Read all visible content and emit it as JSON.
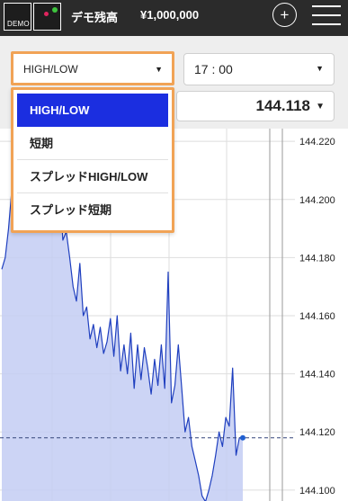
{
  "header": {
    "logo_text": "DEMO",
    "mode_label": "デモ残高",
    "balance": "¥1,000,000",
    "plus_icon": "+"
  },
  "controls": {
    "trade_type": "HIGH/LOW",
    "expiry_time": "17 : 00",
    "rate": "144.118",
    "caret": "▼"
  },
  "dropdown": {
    "items": [
      "HIGH/LOW",
      "短期",
      "スプレッドHIGH/LOW",
      "スプレッド短期"
    ],
    "selected_index": 0
  },
  "chart_data": {
    "type": "area",
    "title": "",
    "xlabel": "",
    "ylabel": "",
    "ylim": [
      144.095,
      144.225
    ],
    "yticks": [
      "144.220",
      "144.200",
      "144.180",
      "144.160",
      "144.140",
      "144.120",
      "144.100"
    ],
    "current_rate": 144.118,
    "series": [
      {
        "values": [
          144.176,
          144.18,
          144.19,
          144.204,
          144.196,
          144.21,
          144.213,
          144.218,
          144.215,
          144.221,
          144.219,
          144.217,
          144.22,
          144.22,
          144.219,
          144.216,
          144.202,
          144.206,
          144.186,
          144.189,
          144.18,
          144.17,
          144.165,
          144.178,
          144.16,
          144.163,
          144.152,
          144.157,
          144.149,
          144.156,
          144.147,
          144.151,
          144.159,
          144.146,
          144.16,
          144.141,
          144.15,
          144.14,
          144.154,
          144.135,
          144.15,
          144.138,
          144.149,
          144.142,
          144.133,
          144.145,
          144.136,
          144.15,
          144.135,
          144.175,
          144.13,
          144.136,
          144.15,
          144.135,
          144.12,
          144.125,
          144.115,
          144.11,
          144.105,
          144.098,
          144.096,
          144.1,
          144.105,
          144.112,
          144.12,
          144.115,
          144.125,
          144.122,
          144.142,
          144.112,
          144.118,
          144.118
        ]
      }
    ],
    "colors": {
      "line": "#1f3fbf",
      "fill": "#c3cdf3",
      "grid": "#dedede",
      "current_line": "#33447a"
    }
  }
}
